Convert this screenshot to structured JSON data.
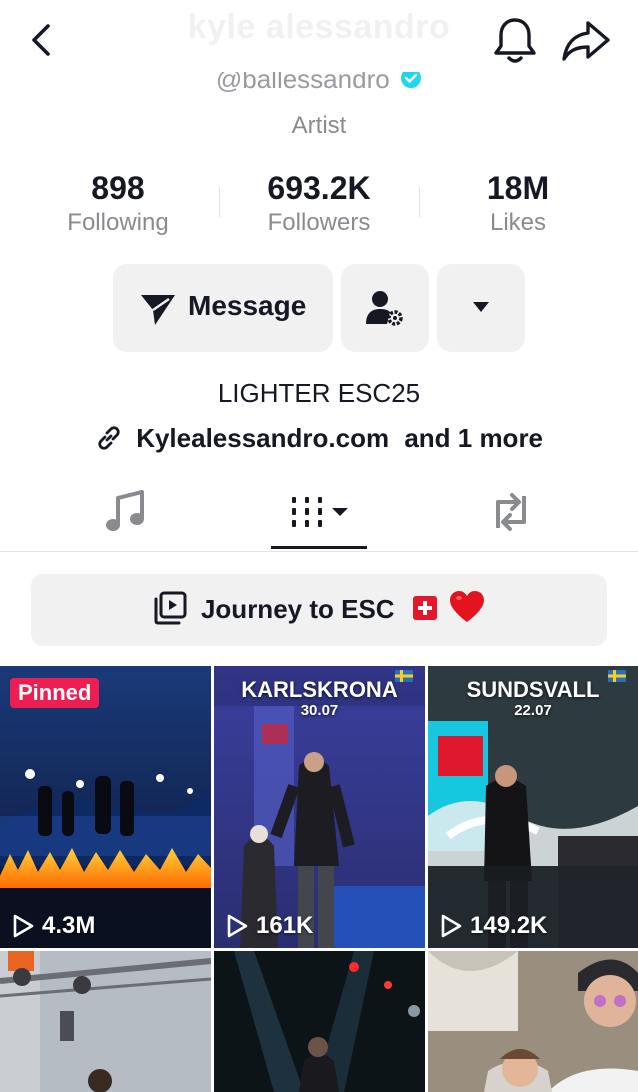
{
  "header": {
    "ghost_title": "kyle alessandro",
    "handle": "@ballessandro",
    "role": "Artist"
  },
  "stats": [
    {
      "value": "898",
      "label": "Following"
    },
    {
      "value": "693.2K",
      "label": "Followers"
    },
    {
      "value": "18M",
      "label": "Likes"
    }
  ],
  "actions": {
    "message_label": "Message"
  },
  "bio": {
    "text": "LIGHTER ESC25",
    "link": "Kylealessandro.com",
    "link_more": "and 1 more"
  },
  "playlist": {
    "label": "Journey to ESC"
  },
  "videos": [
    {
      "views": "4.3M",
      "pinned_label": "Pinned",
      "city": "",
      "date": ""
    },
    {
      "views": "161K",
      "pinned_label": "",
      "city": "KARLSKRONA",
      "date": "30.07"
    },
    {
      "views": "149.2K",
      "pinned_label": "",
      "city": "SUNDSVALL",
      "date": "22.07"
    },
    {
      "views": "",
      "pinned_label": "",
      "city": "",
      "date": ""
    },
    {
      "views": "",
      "pinned_label": "",
      "city": "",
      "date": ""
    },
    {
      "views": "",
      "pinned_label": "",
      "city": "",
      "date": ""
    }
  ],
  "icons": {
    "back": "chevron-left-icon",
    "bell": "bell-icon",
    "share": "share-arrow-icon",
    "verified": "verified-badge-icon",
    "message": "paper-plane-icon",
    "add_user": "user-settings-icon",
    "more": "caret-down-icon",
    "link": "link-icon",
    "music_tab": "music-note-icon",
    "videos_tab": "grid-bars-icon",
    "repost_tab": "repost-icon",
    "playlist": "playlist-icon",
    "play": "play-outline-icon"
  },
  "colors": {
    "accent_red": "#ee1d52",
    "verified_blue": "#20d5ec",
    "button_bg": "#f1f1f2",
    "text_primary": "#161823",
    "text_secondary": "#8a8b91"
  }
}
